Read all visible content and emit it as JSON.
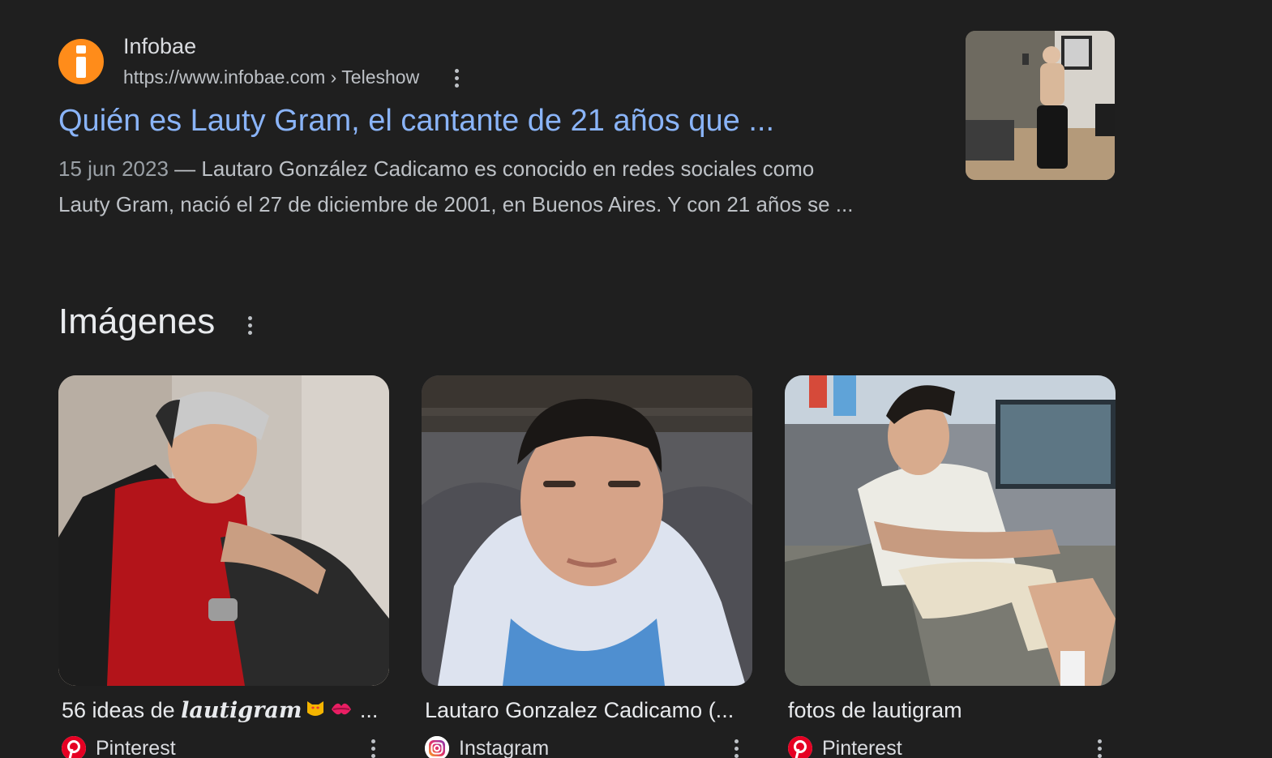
{
  "result": {
    "site_name": "Infobae",
    "url": "https://www.infobae.com › Teleshow",
    "title": "Quién es Lauty Gram, el cantante de 21 años que ...",
    "date": "15 jun 2023",
    "snippet_line1": "Lautaro González Cadicamo es conocido en redes sociales como",
    "snippet_line2": "Lauty Gram, nació el 27 de diciembre de 2001, en Buenos Aires. Y con 21 años se ...",
    "favicon_color": "#ff8c1a"
  },
  "images": {
    "heading": "Imágenes",
    "cards": [
      {
        "caption_prefix": "56 ideas de ",
        "caption_script": "lautigram",
        "caption_suffix": " ...",
        "source": "Pinterest",
        "source_icon": "pinterest-icon"
      },
      {
        "caption": "Lautaro Gonzalez Cadicamo (...",
        "source": "Instagram",
        "source_icon": "instagram-icon"
      },
      {
        "caption": "fotos de lautigram",
        "source": "Pinterest",
        "source_icon": "pinterest-icon"
      }
    ]
  },
  "colors": {
    "background": "#1f1f1f",
    "link": "#8ab4f8",
    "text": "#e8eaed",
    "muted": "#bdc1c6",
    "pinterest": "#e60023"
  }
}
